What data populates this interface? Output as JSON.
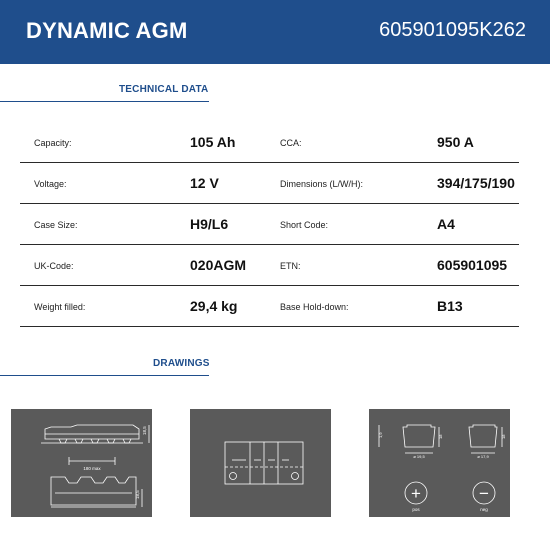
{
  "header": {
    "title": "DYNAMIC AGM",
    "code": "605901095K262"
  },
  "technical": {
    "heading": "TECHNICAL DATA",
    "rows": [
      {
        "label_left": "Capacity:",
        "value_left": "105 Ah",
        "label_right": "CCA:",
        "value_right": "950 A"
      },
      {
        "label_left": "Voltage:",
        "value_left": "12 V",
        "label_right": "Dimensions (L/W/H):",
        "value_right": "394/175/190"
      },
      {
        "label_left": "Case Size:",
        "value_left": "H9/L6",
        "label_right": "Short Code:",
        "value_right": "A4"
      },
      {
        "label_left": "UK-Code:",
        "value_left": "020AGM",
        "label_right": "ETN:",
        "value_right": "605901095"
      },
      {
        "label_left": "Weight filled:",
        "value_left": "29,4 kg",
        "label_right": "Base Hold-down:",
        "value_right": "B13"
      }
    ]
  },
  "drawings": {
    "heading": "DRAWINGS",
    "side_view": {
      "dim_height_top": "18,5",
      "dim_width": "180 max",
      "dim_height_bottom": "18,5"
    },
    "terminals": {
      "left_side_dim": "1,9",
      "pos_height": "18",
      "pos_diameter": "ø 19,5",
      "neg_height": "18",
      "neg_diameter": "ø 17,9",
      "pos_symbol": "+",
      "neg_symbol": "−",
      "pos_label": "pos",
      "neg_label": "neg"
    },
    "panel_color": "#5a5a5a",
    "line_color": "#ffffff"
  },
  "colors": {
    "brand": "#1f4e8c"
  }
}
